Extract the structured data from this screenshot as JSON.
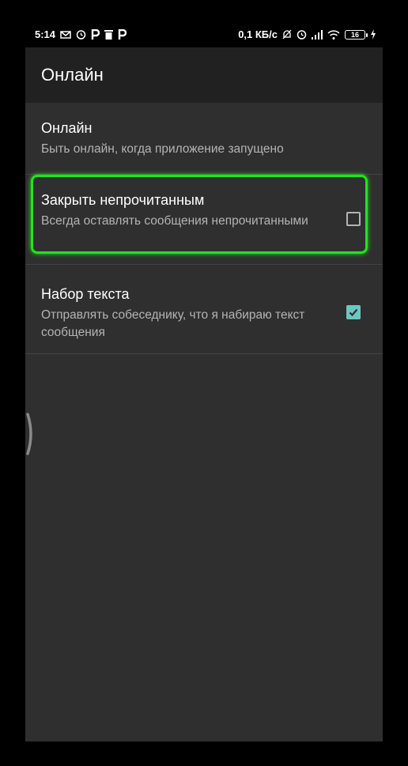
{
  "statusbar": {
    "time": "5:14",
    "network_speed": "0,1 КБ/с",
    "battery_level": "16",
    "left_icons": [
      "mail-icon",
      "alarm-icon",
      "p-icon",
      "trash-icon",
      "p-icon"
    ],
    "right_icons": [
      "mute-icon",
      "alarm-icon",
      "signal-icon",
      "wifi-icon",
      "battery-icon",
      "charging-icon"
    ]
  },
  "appbar": {
    "title": "Онлайн"
  },
  "preferences": [
    {
      "title": "Онлайн",
      "summary": "Быть онлайн, когда приложение запущено",
      "has_checkbox": false
    },
    {
      "title": "Закрыть непрочитанным",
      "summary": "Всегда оставлять сообщения непрочитанными",
      "has_checkbox": true,
      "checked": false
    },
    {
      "title": "Набор текста",
      "summary": "Отправлять собеседнику, что я набираю текст сообщения",
      "has_checkbox": true,
      "checked": true
    }
  ],
  "colors": {
    "background": "#2f2f2f",
    "appbar": "#212121",
    "accent": "#6cc7c2",
    "highlight": "#22e31d"
  }
}
